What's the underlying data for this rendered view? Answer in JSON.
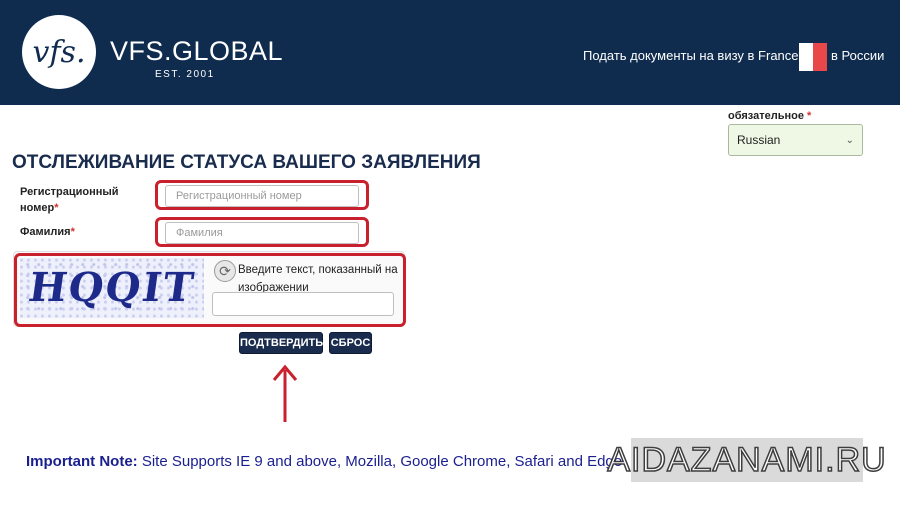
{
  "header": {
    "logo_mark": "vfs.",
    "logo_name": "VFS.GLOBAL",
    "logo_est": "EST. 2001",
    "visa_text": "Подать документы на визу в France",
    "country_text": "в России",
    "flag_colors": [
      "#ffffff",
      "#e8484a"
    ],
    "background": "#0f2b4d"
  },
  "language": {
    "label": "обязательное",
    "required_mark": "*",
    "selected": "Russian"
  },
  "form": {
    "title": "ОТСЛЕЖИВАНИЕ СТАТУСА ВАШЕГО ЗАЯВЛЕНИЯ",
    "reg_label_line1": "Регистрационный",
    "reg_label_line2": "номер",
    "reg_required": "*",
    "reg_placeholder": "Регистрационный номер",
    "surname_label": "Фамилия",
    "surname_required": "*",
    "surname_placeholder": "Фамилия"
  },
  "captcha": {
    "image_text": "HQQIT",
    "label": "Введите текст, показанный на изображении",
    "input_value": ""
  },
  "buttons": {
    "submit": "ПОДТВЕРДИТЬ",
    "reset": "СБРОС"
  },
  "note": {
    "bold": "Important Note:",
    "text": " Site Supports IE 9 and above, Mozilla, Google Chrome, Safari and Edge"
  },
  "watermark": "AIDAZANAMI.RU",
  "accent_colors": {
    "highlight": "#c8202d",
    "button": "#1a2c4e",
    "note_text": "#1a1f8f"
  }
}
